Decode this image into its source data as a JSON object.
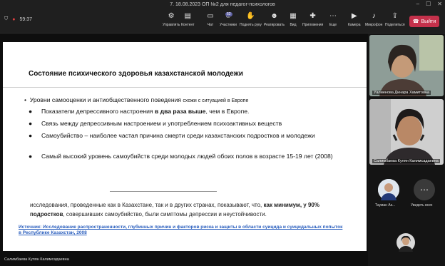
{
  "window": {
    "title": "7. 18.08.2023 ОП №2 для педагог-психологов"
  },
  "toolbar": {
    "timer": "59:37",
    "items": [
      {
        "label": "Управлять",
        "icon": "manage-icon"
      },
      {
        "label": "Контент",
        "icon": "content-icon"
      },
      {
        "label": "Чат",
        "icon": "chat-icon"
      },
      {
        "label": "Участники",
        "icon": "people-icon",
        "badge": "52"
      },
      {
        "label": "Поднять руку",
        "icon": "hand-icon"
      },
      {
        "label": "Реагировать",
        "icon": "react-icon"
      },
      {
        "label": "Вид",
        "icon": "view-icon"
      },
      {
        "label": "Приложения",
        "icon": "apps-icon"
      },
      {
        "label": "Еще",
        "icon": "more-icon"
      },
      {
        "label": "Камера",
        "icon": "camera-icon"
      },
      {
        "label": "Микрофон",
        "icon": "mic-icon"
      },
      {
        "label": "Поделиться",
        "icon": "share-icon"
      }
    ],
    "leave_label": "Выйти"
  },
  "slide": {
    "title": "Состояние психического здоровья казахстанской молодежи",
    "main_bullet": "Уровни самооценки и антиобщественного поведения",
    "main_bullet_small": "схожи с ситуацией в Европе",
    "sub1_a": "Показатели депрессивного настроения ",
    "sub1_b": "в два раза выше",
    "sub1_c": ", чем в Европе.",
    "sub2": "Связь между депрессивным настроением и употреблением психоактивных веществ",
    "sub3": "Самоубийство – наиболее частая причина смерти среди казахстанских подростков и молодежи",
    "sub4": "Самый высокий уровень самоубийств среди молодых людей обоих полов в возрасте 15-19 лет (2008)",
    "para_a": "исследования, проведенные как в Казахстане, так и в других странах, показывают, что, ",
    "para_b": "как минимум, у 90% подростков",
    "para_c": ", совершивших самоубийство, были симптомы депрессии и неустойчивости.",
    "source": "Источник: Исследование распространенности, глубинных причин и факторов риска и защиты в области суицида и суицидальных попыток в Республике Казахстан, 2008"
  },
  "presenter_name": "Салимбаева Кулян Калимсадаевна",
  "participants": [
    {
      "name": "Уалиенова Динара Хамитовна"
    },
    {
      "name": "Салимбаева Кулян Калимсадаевна"
    }
  ],
  "small_participants": [
    {
      "name": "Тауман Ак..."
    },
    {
      "name": "Увидеть всех"
    }
  ]
}
